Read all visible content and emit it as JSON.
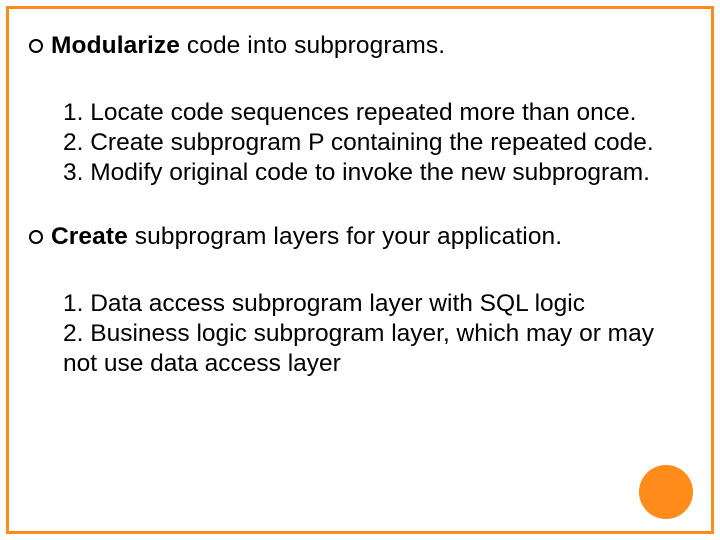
{
  "slide": {
    "sections": [
      {
        "heading_bold": "Modularize",
        "heading_rest": " code into subprograms.",
        "items": [
          "1. Locate code sequences repeated more than once.",
          "2. Create subprogram P containing the repeated code.",
          "3. Modify original code to invoke the new subprogram."
        ]
      },
      {
        "heading_bold": "Create",
        "heading_rest": " subprogram layers for your application.",
        "items": [
          "1. Data access subprogram layer with SQL logic",
          "2. Business logic subprogram layer, which may or may not use data access layer"
        ]
      }
    ]
  }
}
